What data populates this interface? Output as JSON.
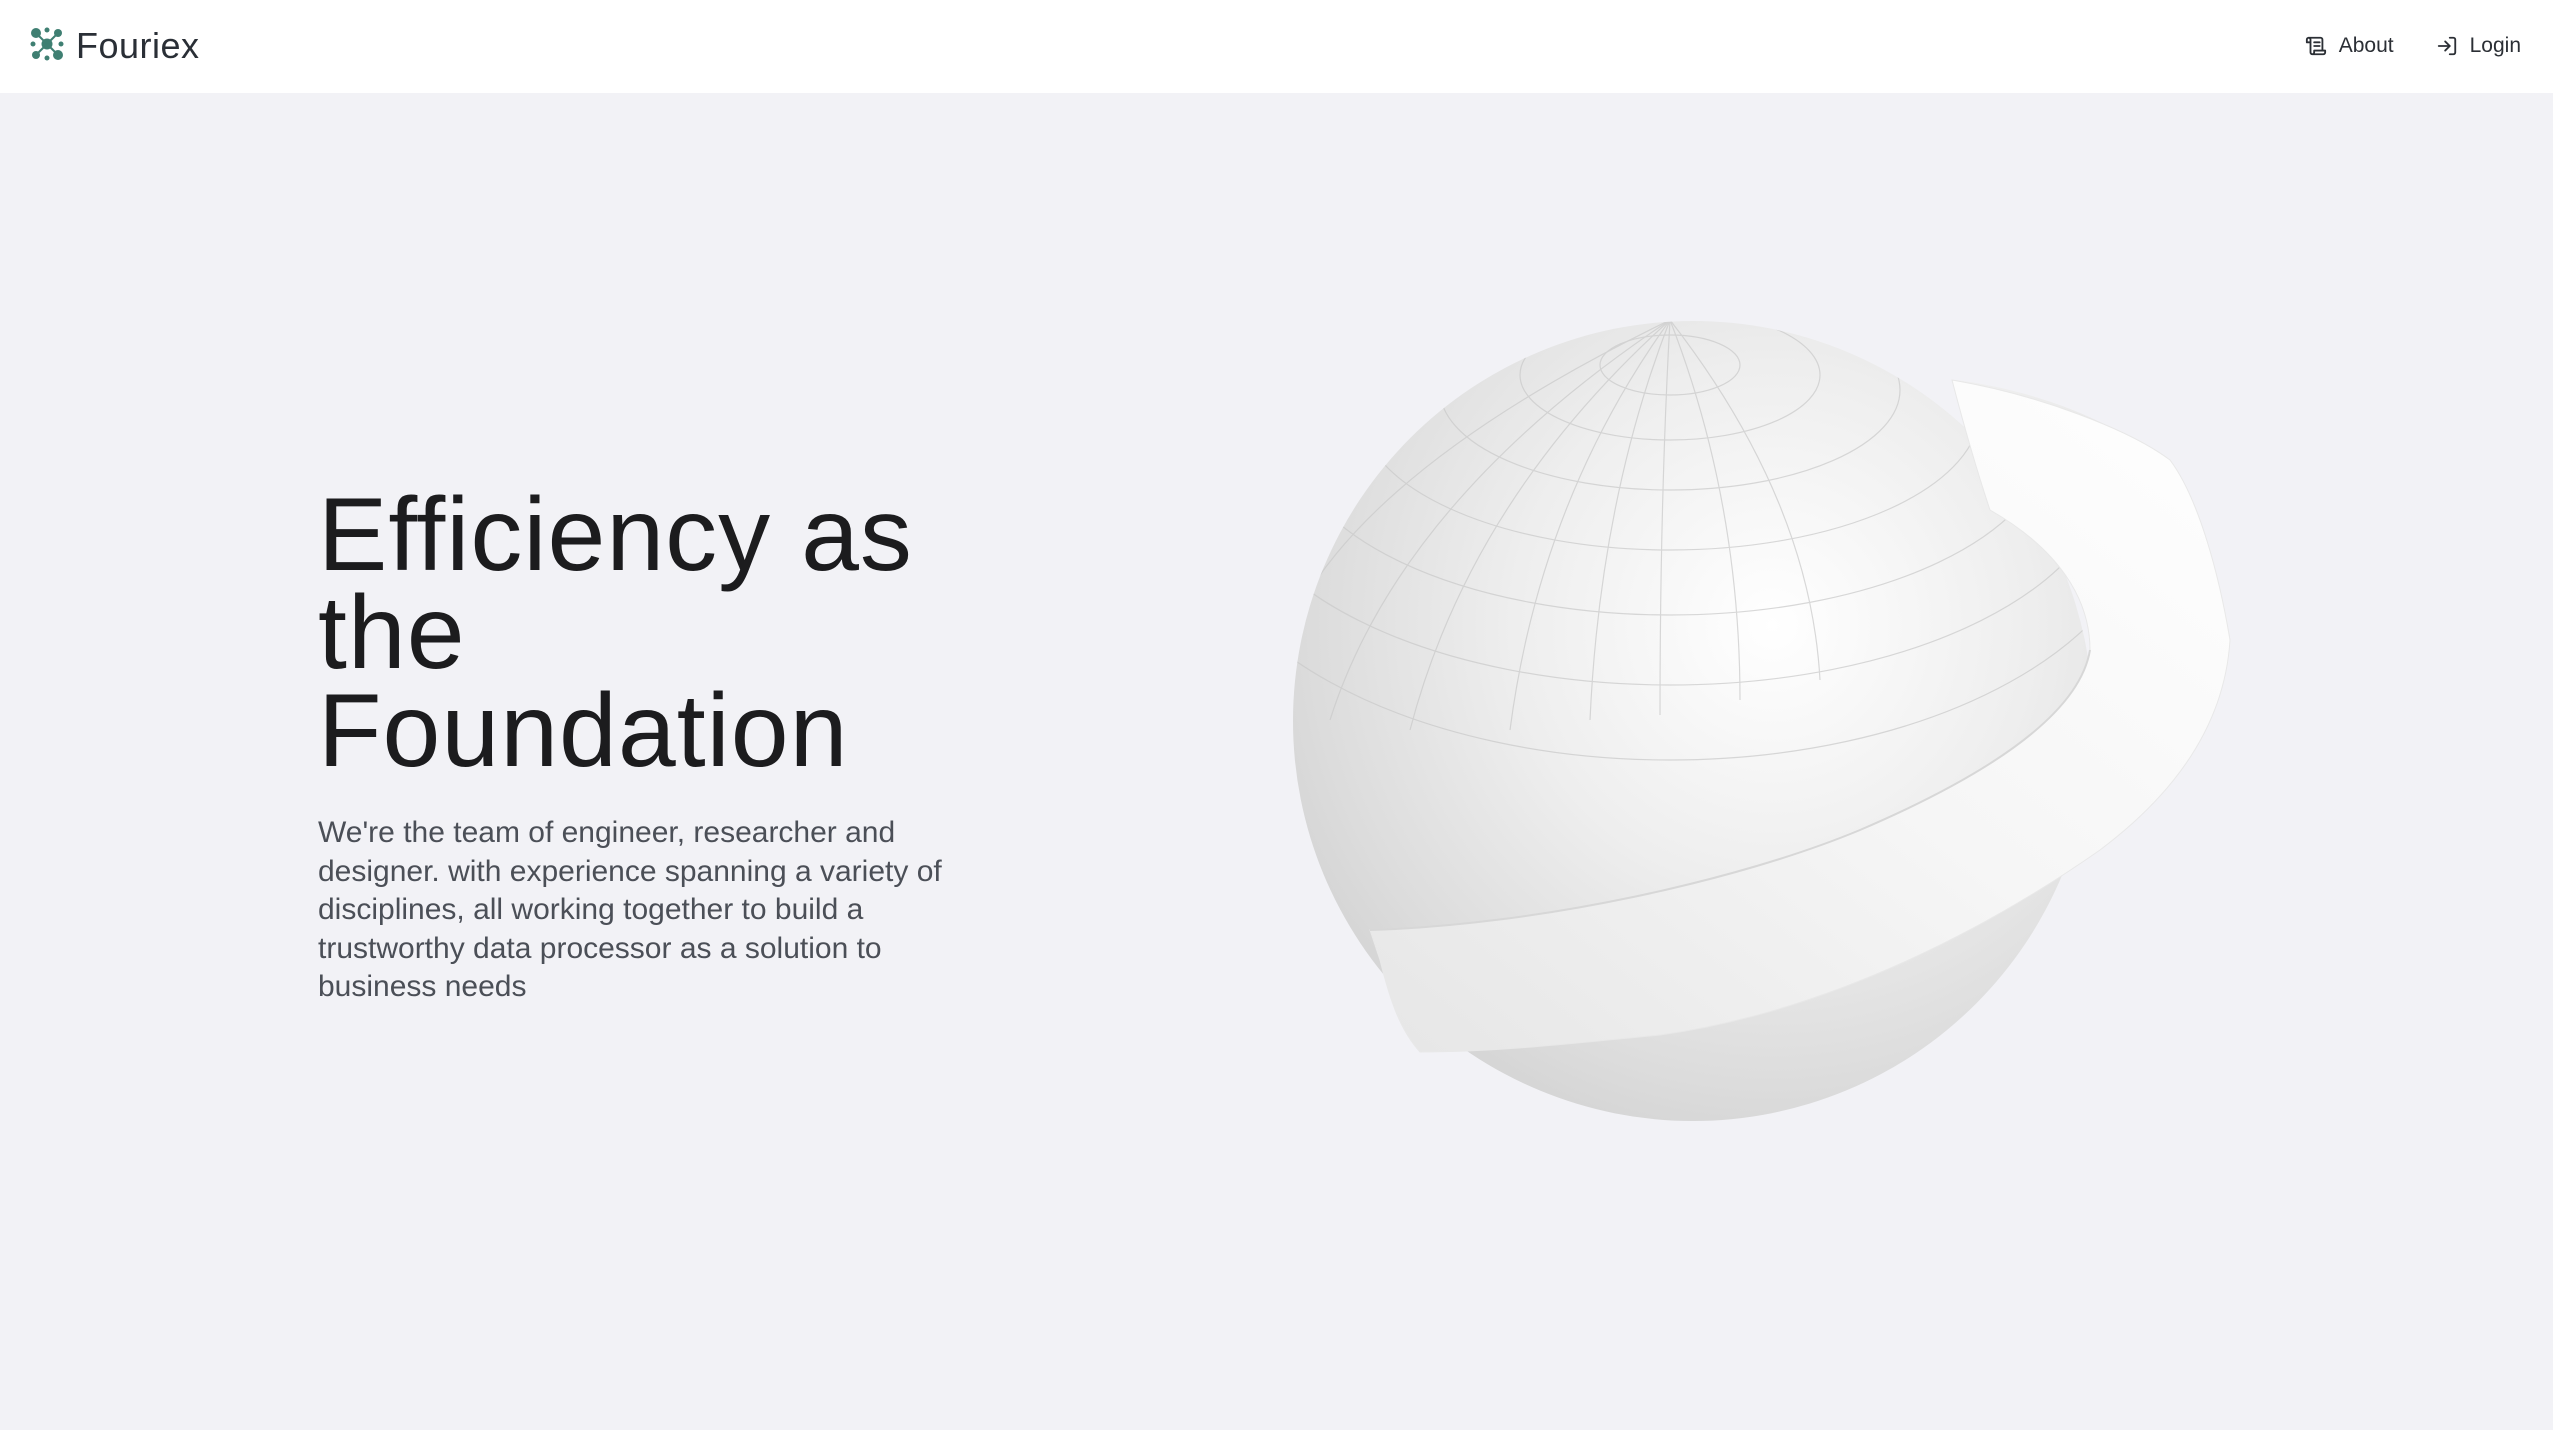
{
  "header": {
    "brand_name": "Fouriex",
    "nav": [
      {
        "label": "About",
        "icon": "scroll-icon"
      },
      {
        "label": "Login",
        "icon": "login-icon"
      }
    ]
  },
  "hero": {
    "title_lines": [
      "Efficiency as",
      "the",
      "Foundation"
    ],
    "description": "We're the team of engineer, researcher and designer. with experience spanning a variety of disciplines, all working together to build a trustworthy data processor as a solution to business needs"
  },
  "colors": {
    "page_background": "#f2f2f6",
    "header_background": "#ffffff",
    "logo_accent": "#3f7f72",
    "title_text": "#1c1c1e",
    "body_text": "#4b4f57"
  }
}
